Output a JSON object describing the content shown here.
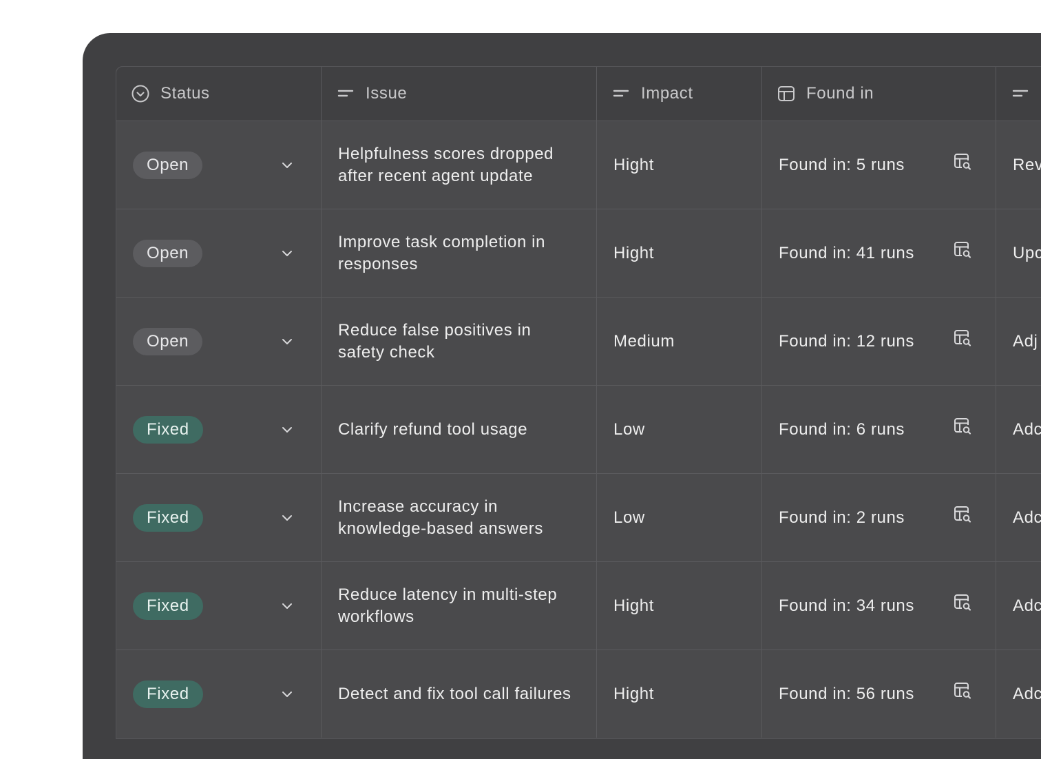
{
  "columns": {
    "status": "Status",
    "issue": "Issue",
    "impact": "Impact",
    "found_in": "Found in",
    "next": ""
  },
  "rows": [
    {
      "status": "Open",
      "status_type": "open",
      "issue": "Helpfulness scores dropped after recent agent update",
      "impact": "Hight",
      "found": "Found in: 5 runs",
      "next": "Rev cha"
    },
    {
      "status": "Open",
      "status_type": "open",
      "issue": "Improve task completion in responses",
      "impact": "Hight",
      "found": "Found in: 41 runs",
      "next": "Upc"
    },
    {
      "status": "Open",
      "status_type": "open",
      "issue": "Reduce false positives in safety check",
      "impact": "Medium",
      "found": "Found in: 12 runs",
      "next": "Adj"
    },
    {
      "status": "Fixed",
      "status_type": "fixed",
      "issue": "Clarify refund tool usage",
      "impact": "Low",
      "found": "Found in: 6 runs",
      "next": "Adc"
    },
    {
      "status": "Fixed",
      "status_type": "fixed",
      "issue": "Increase accuracy in knowledge-based answers",
      "impact": "Low",
      "found": "Found in: 2 runs",
      "next": "Adc"
    },
    {
      "status": "Fixed",
      "status_type": "fixed",
      "issue": "Reduce latency in multi-step workflows",
      "impact": "Hight",
      "found": "Found in: 34 runs",
      "next": "Adc"
    },
    {
      "status": "Fixed",
      "status_type": "fixed",
      "issue": "Detect and fix tool call failures",
      "impact": "Hight",
      "found": "Found in: 56 runs",
      "next": "Adc"
    }
  ],
  "colors": {
    "panel": "#404042",
    "open_badge": "#5c5c5f",
    "fixed_badge": "#3f6b62"
  },
  "icons": {
    "status_header": "circle-chevron-icon",
    "text_header": "text-lines-icon",
    "found_header": "table-icon",
    "row_action": "table-search-icon",
    "dropdown": "chevron-down-icon"
  }
}
